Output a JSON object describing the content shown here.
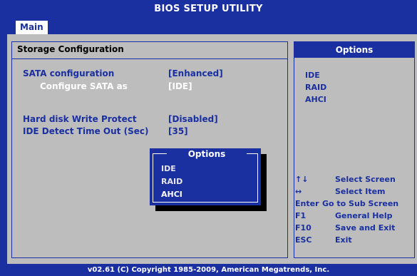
{
  "title": "BIOS SETUP UTILITY",
  "tabs": [
    {
      "label": "Main"
    }
  ],
  "left_panel": {
    "header": "Storage Configuration",
    "rows": [
      {
        "label": "SATA configuration",
        "value": "[Enhanced]"
      },
      {
        "label": "Configure SATA as",
        "value": "[IDE]"
      },
      {
        "label": "Hard disk Write Protect",
        "value": "[Disabled]"
      },
      {
        "label": "IDE Detect Time Out (Sec)",
        "value": "[35]"
      }
    ]
  },
  "right_panel": {
    "header": "Options",
    "options": [
      "IDE",
      "RAID",
      "AHCI"
    ],
    "help": [
      {
        "key": "↑↓",
        "desc": "Select Screen"
      },
      {
        "key": "↔",
        "desc": "Select Item"
      },
      {
        "key": "Enter",
        "desc": "Go to Sub Screen"
      },
      {
        "key": "F1",
        "desc": "General Help"
      },
      {
        "key": "F10",
        "desc": "Save and Exit"
      },
      {
        "key": "ESC",
        "desc": "Exit"
      }
    ]
  },
  "popup": {
    "title": "Options",
    "items": [
      "IDE",
      "RAID",
      "AHCI"
    ],
    "selected": "AHCI"
  },
  "footer": "v02.61 (C) Copyright 1985-2009, American Megatrends, Inc.",
  "colors": {
    "bios_blue": "#1a2fa0",
    "panel_gray": "#bdbdbd",
    "text_white": "#ffffff"
  }
}
